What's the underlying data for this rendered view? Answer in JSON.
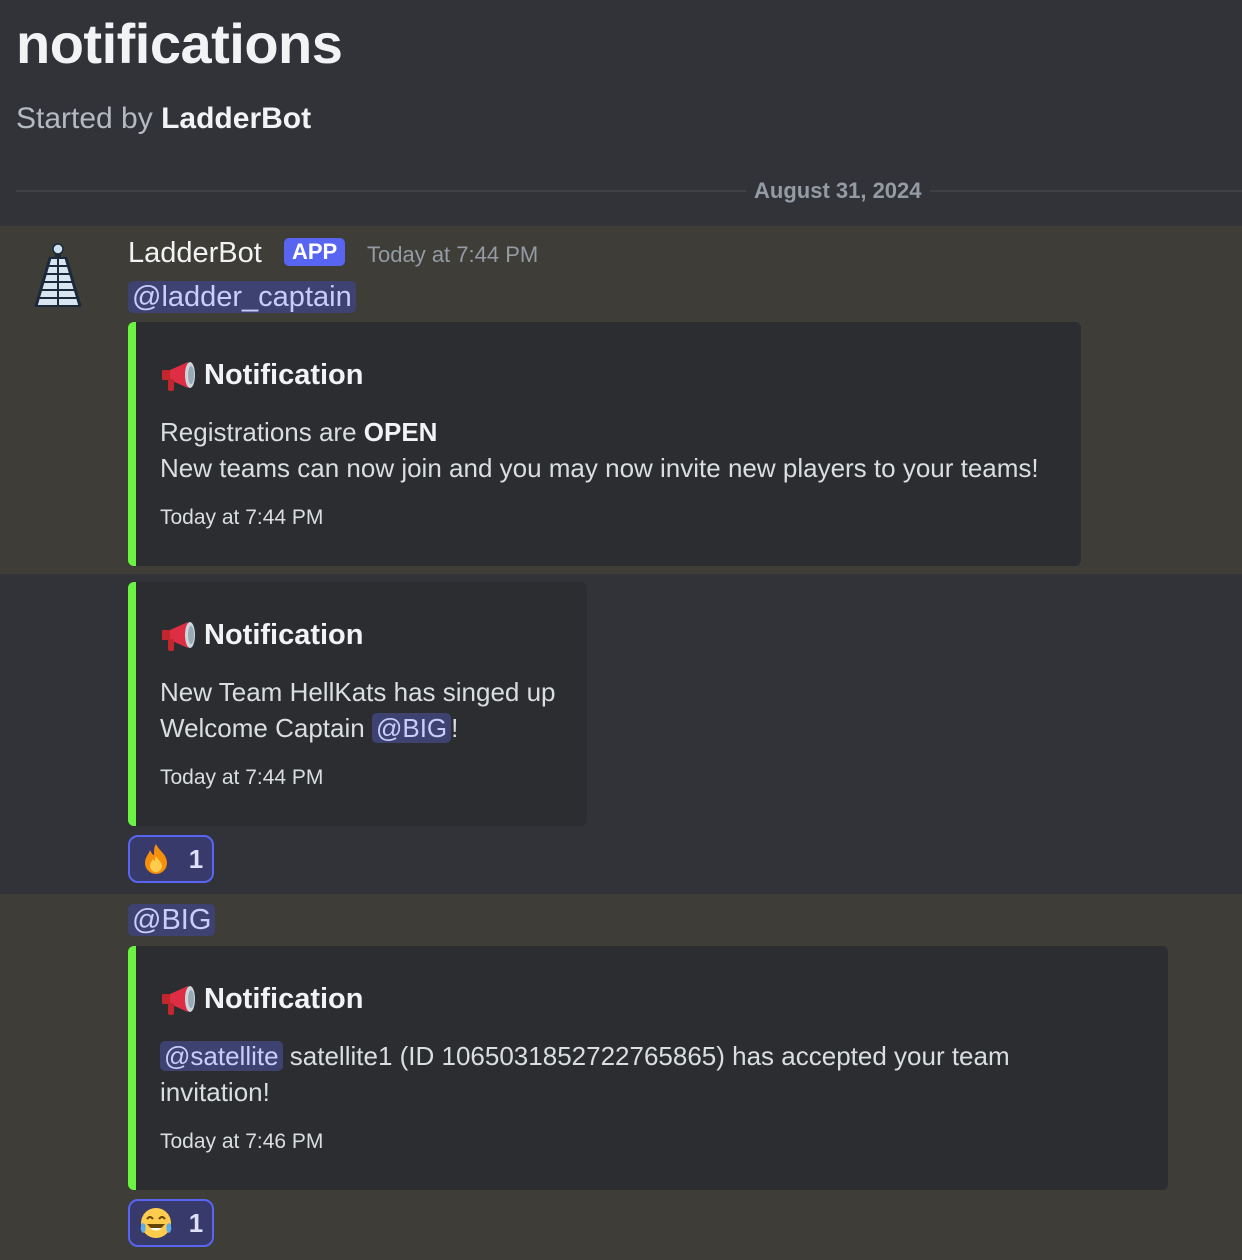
{
  "thread": {
    "title": "notifications",
    "started_by_prefix": "Started by",
    "started_by_name": "LadderBot"
  },
  "date_divider": "August 31, 2024",
  "message": {
    "author": "LadderBot",
    "tag": "APP",
    "timestamp": "Today at 7:44 PM",
    "mention": "@ladder_captain"
  },
  "embeds": [
    {
      "title": "Notification",
      "line1_prefix": "Registrations are ",
      "line1_bold": "OPEN",
      "line2": "New teams can now join and you may now invite new players to your teams!",
      "footer": "Today at 7:44 PM"
    },
    {
      "title": "Notification",
      "line1": "New Team HellKats has singed up",
      "line2_prefix": "Welcome Captain ",
      "line2_mention": "@BIG",
      "line2_suffix": "!",
      "footer": "Today at 7:44 PM"
    },
    {
      "title": "Notification",
      "mention": "@satellite",
      "line1": " satellite1 (ID 1065031852722765865) has accepted your team",
      "line2": "invitation!",
      "footer": "Today at 7:46 PM"
    }
  ],
  "reactions": [
    {
      "icon": "fire-emoji-icon",
      "count": "1"
    },
    {
      "icon": "tears-of-joy-emoji-icon",
      "count": "1"
    }
  ],
  "third_message_mention": "@BIG",
  "colors": {
    "embed_accent": "#6bf542",
    "app_tag": "#5865f2",
    "mention_bg": "#3e4270",
    "highlight_bg": "#3f3d37"
  }
}
